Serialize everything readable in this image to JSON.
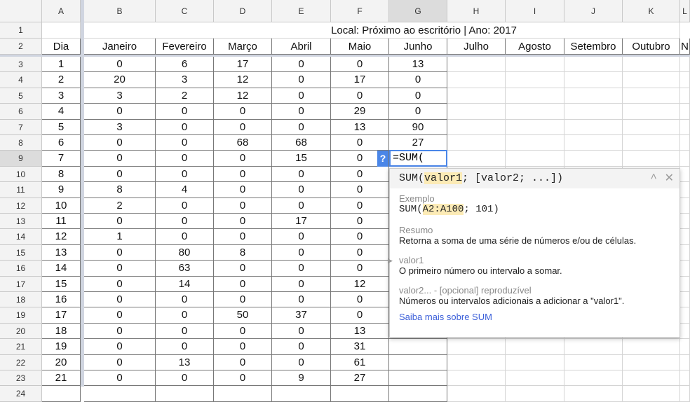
{
  "columns": [
    "A",
    "B",
    "C",
    "D",
    "E",
    "F",
    "G",
    "H",
    "I",
    "J",
    "K",
    "L"
  ],
  "title": "Local: Próximo ao escritório | Ano: 2017",
  "headers": [
    "Dia",
    "Janeiro",
    "Fevereiro",
    "Março",
    "Abril",
    "Maio",
    "Junho",
    "Julho",
    "Agosto",
    "Setembro",
    "Outubro",
    "N"
  ],
  "rows": [
    [
      "1",
      "0",
      "6",
      "17",
      "0",
      "0",
      "13"
    ],
    [
      "2",
      "20",
      "3",
      "12",
      "0",
      "17",
      "0"
    ],
    [
      "3",
      "3",
      "2",
      "12",
      "0",
      "0",
      "0"
    ],
    [
      "4",
      "0",
      "0",
      "0",
      "0",
      "29",
      "0"
    ],
    [
      "5",
      "3",
      "0",
      "0",
      "0",
      "13",
      "90"
    ],
    [
      "6",
      "0",
      "0",
      "68",
      "68",
      "0",
      "27"
    ],
    [
      "7",
      "0",
      "0",
      "0",
      "15",
      "0",
      ""
    ],
    [
      "8",
      "0",
      "0",
      "0",
      "0",
      "0"
    ],
    [
      "9",
      "8",
      "4",
      "0",
      "0",
      "0"
    ],
    [
      "10",
      "2",
      "0",
      "0",
      "0",
      "0"
    ],
    [
      "11",
      "0",
      "0",
      "0",
      "17",
      "0"
    ],
    [
      "12",
      "1",
      "0",
      "0",
      "0",
      "0"
    ],
    [
      "13",
      "0",
      "80",
      "8",
      "0",
      "0"
    ],
    [
      "14",
      "0",
      "63",
      "0",
      "0",
      "0"
    ],
    [
      "15",
      "0",
      "14",
      "0",
      "0",
      "12"
    ],
    [
      "16",
      "0",
      "0",
      "0",
      "0",
      "0"
    ],
    [
      "17",
      "0",
      "0",
      "50",
      "37",
      "0"
    ],
    [
      "18",
      "0",
      "0",
      "0",
      "0",
      "13"
    ],
    [
      "19",
      "0",
      "0",
      "0",
      "0",
      "31"
    ],
    [
      "20",
      "0",
      "13",
      "0",
      "0",
      "61"
    ],
    [
      "21",
      "0",
      "0",
      "0",
      "9",
      "27"
    ]
  ],
  "editor": {
    "value": "=SUM(",
    "help": "?"
  },
  "popup": {
    "sig_pre": "SUM(",
    "sig_arg": "valor1",
    "sig_post": "; [valor2; ...])",
    "example_label": "Exemplo",
    "ex_pre": "SUM(",
    "ex_arg": "A2:A100",
    "ex_post": "; 101)",
    "summary_label": "Resumo",
    "summary": "Retorna a soma de uma série de números e/ou de células.",
    "arg1_label": "valor1",
    "arg1_desc": "O primeiro número ou intervalo a somar.",
    "arg2_label": "valor2... - [opcional] reproduzível",
    "arg2_desc": "Números ou intervalos adicionais a adicionar a \"valor1\".",
    "learn_more": "Saiba mais sobre SUM",
    "collapse": "^",
    "close": "✕"
  }
}
